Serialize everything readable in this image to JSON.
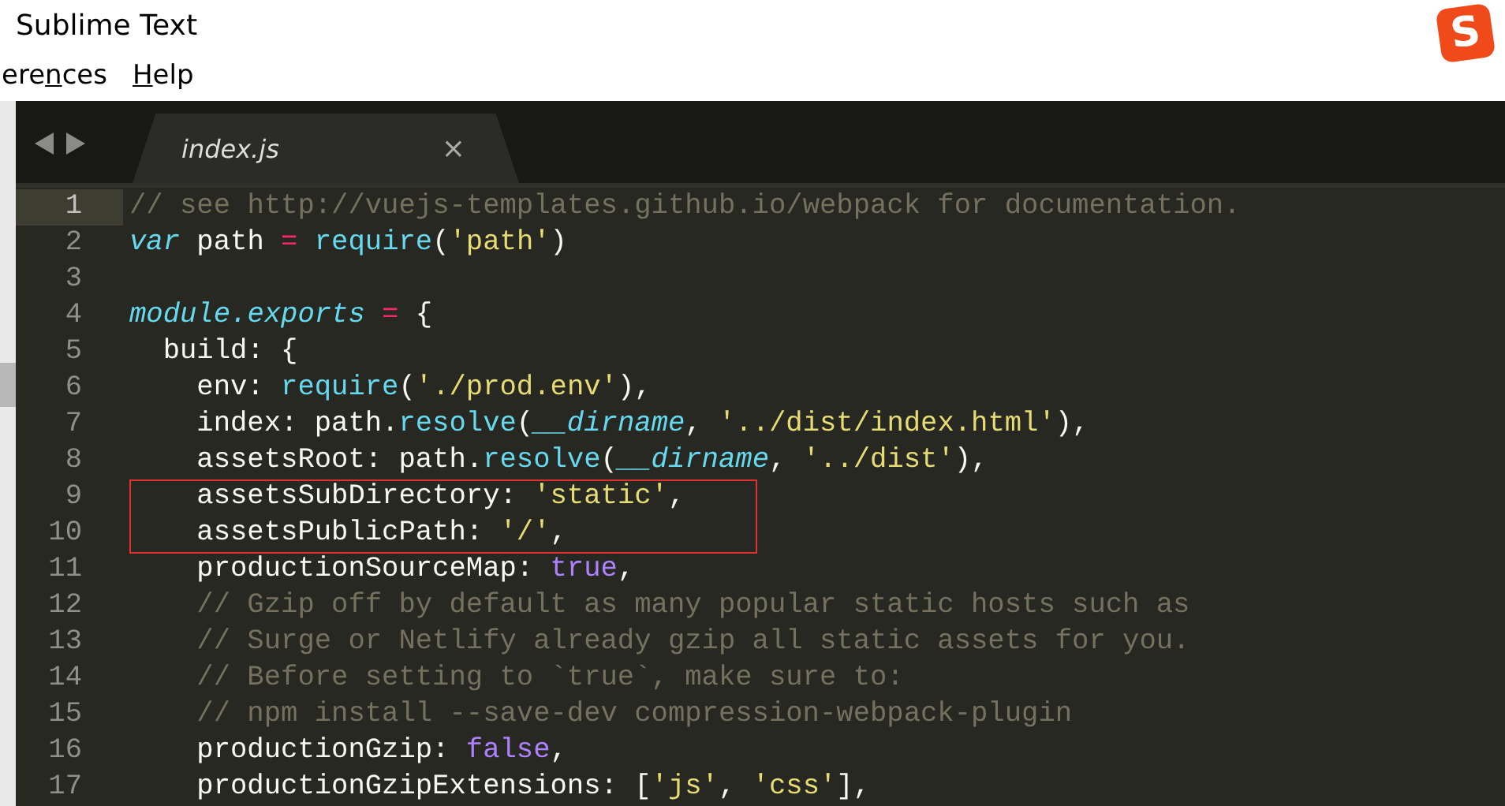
{
  "window": {
    "title": "Sublime Text",
    "logo": "S"
  },
  "menu": [
    {
      "before": "ere",
      "key": "n",
      "after": "ces"
    },
    {
      "key": "H",
      "after": "elp"
    }
  ],
  "tabs": [
    {
      "label": "index.js",
      "selected": true,
      "close": "×"
    }
  ],
  "lines": [
    {
      "number": "1",
      "current": true,
      "boxed": false,
      "tokens": [
        {
          "t": "// see http://vuejs-templates.github.io/webpack for documentation.",
          "kind": "comment"
        }
      ]
    },
    {
      "number": "2",
      "current": false,
      "boxed": false,
      "tokens": [
        {
          "t": "var",
          "kind": "storage"
        },
        {
          "t": " path ",
          "kind": "plain"
        },
        {
          "t": "=",
          "kind": "op"
        },
        {
          "t": " require",
          "kind": "func"
        },
        {
          "t": "(",
          "kind": "plain"
        },
        {
          "t": "'path'",
          "kind": "string"
        },
        {
          "t": ")",
          "kind": "plain"
        }
      ]
    },
    {
      "number": "3",
      "current": false
    },
    {
      "number": "4",
      "current": false,
      "boxed": false,
      "tokens": [
        {
          "t": "module.exports",
          "kind": "storage"
        },
        {
          "t": " =",
          "kind": "op"
        },
        {
          "t": " {",
          "kind": "plain"
        }
      ],
      "children": [
        {
          "number": "5",
          "current": false,
          "boxed": false,
          "tokens": [
            {
              "t": "build: {",
              "kind": "plain"
            }
          ],
          "children": [
            {
              "number": "6",
              "current": false,
              "boxed": false,
              "tokens": [
                {
                  "t": "env: ",
                  "kind": "plain"
                },
                {
                  "t": "require",
                  "kind": "func"
                },
                {
                  "t": "(",
                  "kind": "plain"
                },
                {
                  "t": "'./prod.env'",
                  "kind": "string"
                },
                {
                  "t": "),",
                  "kind": "plain"
                }
              ]
            },
            {
              "number": "7",
              "current": false,
              "boxed": false,
              "tokens": [
                {
                  "t": "index: path.",
                  "kind": "plain"
                },
                {
                  "t": "resolve",
                  "kind": "func"
                },
                {
                  "t": "(",
                  "kind": "plain"
                },
                {
                  "t": "__dirname",
                  "kind": "param"
                },
                {
                  "t": ", ",
                  "kind": "plain"
                },
                {
                  "t": "'../dist/index.html'",
                  "kind": "string"
                },
                {
                  "t": "),",
                  "kind": "plain"
                }
              ]
            },
            {
              "number": "8",
              "current": false,
              "boxed": false,
              "tokens": [
                {
                  "t": "assetsRoot: path.",
                  "kind": "plain"
                },
                {
                  "t": "resolve",
                  "kind": "func"
                },
                {
                  "t": "(",
                  "kind": "plain"
                },
                {
                  "t": "__dirname",
                  "kind": "param"
                },
                {
                  "t": ", ",
                  "kind": "plain"
                },
                {
                  "t": "'../dist'",
                  "kind": "string"
                },
                {
                  "t": "),",
                  "kind": "plain"
                }
              ]
            },
            {
              "number": "9",
              "current": false,
              "boxed": true,
              "tokens": [
                {
                  "t": "assetsSubDirectory: ",
                  "kind": "plain"
                },
                {
                  "t": "'static'",
                  "kind": "string"
                },
                {
                  "t": ",",
                  "kind": "plain"
                }
              ]
            },
            {
              "number": "10",
              "current": false,
              "boxed": true,
              "tokens": [
                {
                  "t": "assetsPublicPath: ",
                  "kind": "plain"
                },
                {
                  "t": "'/'",
                  "kind": "string"
                },
                {
                  "t": ",",
                  "kind": "plain"
                }
              ]
            },
            {
              "number": "11",
              "current": false,
              "boxed": false,
              "tokens": [
                {
                  "t": "productionSourceMap: ",
                  "kind": "plain"
                },
                {
                  "t": "true",
                  "kind": "constant"
                },
                {
                  "t": ",",
                  "kind": "plain"
                }
              ]
            },
            {
              "number": "12",
              "current": false,
              "boxed": false,
              "tokens": [
                {
                  "t": "// Gzip off by default as many popular static hosts such as",
                  "kind": "comment"
                }
              ]
            },
            {
              "number": "13",
              "current": false,
              "boxed": false,
              "tokens": [
                {
                  "t": "// Surge or Netlify already gzip all static assets for you.",
                  "kind": "comment"
                }
              ]
            },
            {
              "number": "14",
              "current": false,
              "boxed": false,
              "tokens": [
                {
                  "t": "// Before setting to `true`, make sure to:",
                  "kind": "comment"
                }
              ]
            },
            {
              "number": "15",
              "current": false,
              "boxed": false,
              "tokens": [
                {
                  "t": "// npm install --save-dev compression-webpack-plugin",
                  "kind": "comment"
                }
              ]
            },
            {
              "number": "16",
              "current": false,
              "boxed": false,
              "tokens": [
                {
                  "t": "productionGzip: ",
                  "kind": "plain"
                },
                {
                  "t": "false",
                  "kind": "constant"
                },
                {
                  "t": ",",
                  "kind": "plain"
                }
              ]
            },
            {
              "number": "17",
              "current": false,
              "boxed": false,
              "tokens": [
                {
                  "t": "productionGzipExtensions: [",
                  "kind": "plain"
                },
                {
                  "t": "'js'",
                  "kind": "string"
                },
                {
                  "t": ", ",
                  "kind": "plain"
                },
                {
                  "t": "'css'",
                  "kind": "string"
                },
                {
                  "t": "],",
                  "kind": "plain"
                }
              ]
            }
          ]
        }
      ]
    }
  ]
}
